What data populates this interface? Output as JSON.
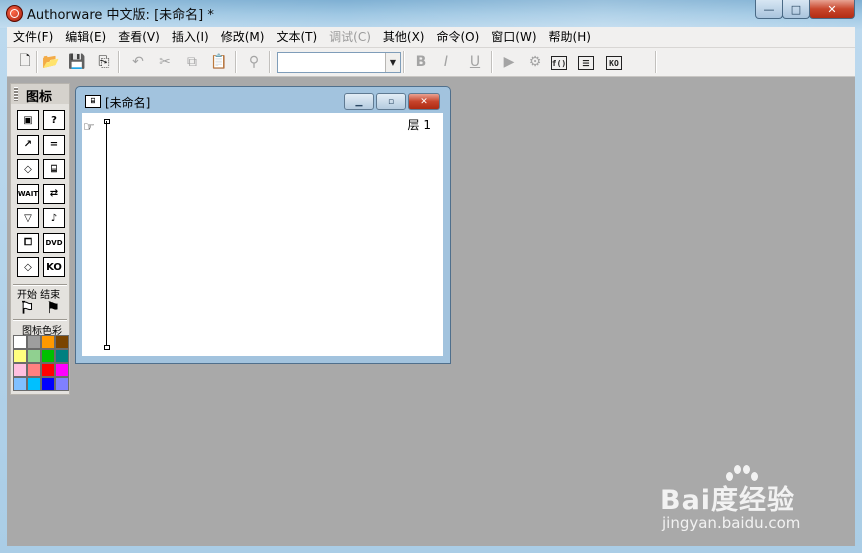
{
  "window": {
    "title": "Authorware 中文版: [未命名] *",
    "controls": {
      "minimize": "—",
      "maximize": "□",
      "close": "✕"
    }
  },
  "menubar": {
    "items": [
      {
        "label": "文件(F)",
        "enabled": true
      },
      {
        "label": "编辑(E)",
        "enabled": true
      },
      {
        "label": "查看(V)",
        "enabled": true
      },
      {
        "label": "插入(I)",
        "enabled": true
      },
      {
        "label": "修改(M)",
        "enabled": true
      },
      {
        "label": "文本(T)",
        "enabled": true
      },
      {
        "label": "调试(C)",
        "enabled": false
      },
      {
        "label": "其他(X)",
        "enabled": true
      },
      {
        "label": "命令(O)",
        "enabled": true
      },
      {
        "label": "窗口(W)",
        "enabled": true
      },
      {
        "label": "帮助(H)",
        "enabled": true
      }
    ]
  },
  "toolbar": {
    "buttons": [
      {
        "name": "new-file-icon",
        "glyph": "🗋"
      },
      {
        "name": "open-file-icon",
        "glyph": "📂"
      },
      {
        "name": "save-all-icon",
        "glyph": "💾"
      },
      {
        "name": "import-icon",
        "glyph": "⎘"
      },
      {
        "name": "undo-icon",
        "glyph": "↶"
      },
      {
        "name": "cut-icon",
        "glyph": "✂"
      },
      {
        "name": "copy-icon",
        "glyph": "⧉"
      },
      {
        "name": "paste-icon",
        "glyph": "📋"
      },
      {
        "name": "find-icon",
        "glyph": "⚲"
      },
      {
        "name": "bold-icon",
        "glyph": "B"
      },
      {
        "name": "italic-icon",
        "glyph": "I"
      },
      {
        "name": "underline-icon",
        "glyph": "U"
      },
      {
        "name": "run-icon",
        "glyph": "▶"
      },
      {
        "name": "control-panel-icon",
        "glyph": "⚙"
      },
      {
        "name": "functions-icon",
        "glyph": "f()"
      },
      {
        "name": "variables-icon",
        "glyph": "☰"
      },
      {
        "name": "knowledge-objects-icon",
        "glyph": "KO"
      }
    ],
    "font_combo_value": ""
  },
  "palette": {
    "title": "图标",
    "start_end_label": "开始 结束",
    "colors_label": "图标色彩",
    "icons": [
      {
        "name": "display-icon",
        "glyph": "▣"
      },
      {
        "name": "interaction-icon",
        "glyph": "?"
      },
      {
        "name": "motion-icon",
        "glyph": "↗"
      },
      {
        "name": "calculation-icon",
        "glyph": "="
      },
      {
        "name": "erase-icon",
        "glyph": "◇"
      },
      {
        "name": "map-icon",
        "glyph": "⌸"
      },
      {
        "name": "wait-icon",
        "glyph": "WAIT"
      },
      {
        "name": "navigate-icon",
        "glyph": "⇄"
      },
      {
        "name": "decision-icon",
        "glyph": "▽"
      },
      {
        "name": "sound-icon",
        "glyph": "♪"
      },
      {
        "name": "framework-icon",
        "glyph": "⧠"
      },
      {
        "name": "dvd-icon",
        "glyph": "DVD"
      },
      {
        "name": "interaction-diamond-icon",
        "glyph": "◇"
      },
      {
        "name": "ko-icon",
        "glyph": "KO"
      }
    ],
    "flags": [
      {
        "name": "start-flag-icon",
        "glyph": "⚑"
      },
      {
        "name": "end-flag-icon",
        "glyph": "⚑"
      }
    ],
    "swatches": [
      "#ffffff",
      "#9e9e9e",
      "#ff9900",
      "#7a4400",
      "#ffff80",
      "#90d090",
      "#00c000",
      "#008080",
      "#ffc0e0",
      "#ff8080",
      "#ff0000",
      "#ff00ff",
      "#80c0ff",
      "#00c0ff",
      "#0000ff",
      "#8080ff"
    ]
  },
  "design_window": {
    "title": "[未命名]",
    "layer_label": "层 1"
  },
  "watermark": {
    "text": "Bai度经验",
    "url": "jingyan.baidu.com"
  }
}
